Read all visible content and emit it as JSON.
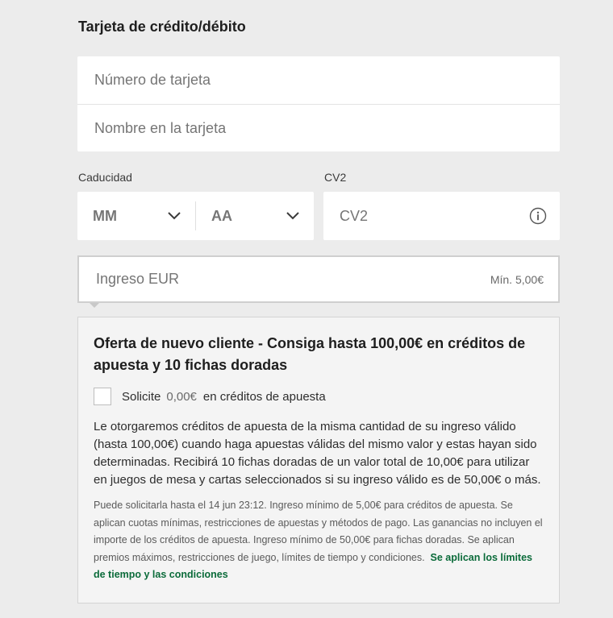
{
  "section_title": "Tarjeta de crédito/débito",
  "card_number": {
    "placeholder": "Número de tarjeta",
    "value": ""
  },
  "card_name": {
    "placeholder": "Nombre en la tarjeta",
    "value": ""
  },
  "expiry": {
    "label": "Caducidad",
    "month_value": "MM",
    "year_value": "AA"
  },
  "cv2": {
    "label": "CV2",
    "placeholder": "CV2",
    "value": "",
    "icon": "info-icon"
  },
  "deposit": {
    "placeholder": "Ingreso EUR",
    "value": "",
    "min_label": "Mín. 5,00€"
  },
  "offer": {
    "title": "Oferta de nuevo cliente - Consiga hasta 100,00€ en créditos de apuesta y 10 fichas doradas",
    "claim_prefix": "Solicite",
    "claim_amount": "0,00€",
    "claim_suffix": "en créditos de apuesta",
    "checked": false,
    "body": "Le otorgaremos créditos de apuesta de la misma cantidad de su ingreso válido (hasta 100,00€) cuando haga apuestas válidas del mismo valor y estas hayan sido determinadas. Recibirá 10 fichas doradas de un valor total de 10,00€ para utilizar en juegos de mesa y cartas seleccionados si su ingreso válido es de 50,00€ o más.",
    "terms": "Puede solicitarla hasta el 14 jun 23:12. Ingreso mínimo de 5,00€ para créditos de apuesta. Se aplican cuotas mínimas, restricciones de apuestas y métodos de pago. Las ganancias no incluyen el importe de los créditos de apuesta. Ingreso mínimo de 50,00€ para fichas doradas. Se aplican premios máximos, restricciones de juego, límites de tiempo y condiciones.",
    "terms_link": "Se aplican los límites de tiempo y las condiciones"
  },
  "colors": {
    "link": "#0b6b3a",
    "background": "#ececec"
  }
}
